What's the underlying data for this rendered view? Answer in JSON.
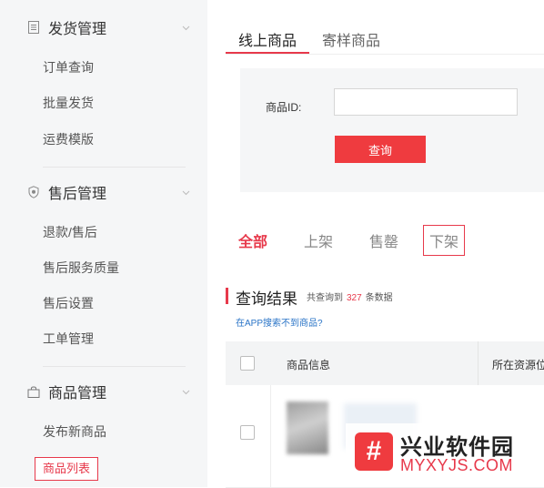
{
  "sidebar": {
    "groups": [
      {
        "title": "发货管理",
        "icon": "document-icon",
        "items": [
          {
            "label": "订单查询"
          },
          {
            "label": "批量发货"
          },
          {
            "label": "运费模版"
          }
        ]
      },
      {
        "title": "售后管理",
        "icon": "shield-icon",
        "items": [
          {
            "label": "退款/售后"
          },
          {
            "label": "售后服务质量"
          },
          {
            "label": "售后设置"
          },
          {
            "label": "工单管理"
          }
        ]
      },
      {
        "title": "商品管理",
        "icon": "bag-icon",
        "items": [
          {
            "label": "发布新商品"
          },
          {
            "label": "商品列表"
          }
        ]
      }
    ]
  },
  "main": {
    "tabs": [
      {
        "label": "线上商品"
      },
      {
        "label": "寄样商品"
      }
    ],
    "search": {
      "label": "商品ID:",
      "value": "",
      "placeholder": "",
      "button": "查询"
    },
    "filters": [
      {
        "label": "全部"
      },
      {
        "label": "上架"
      },
      {
        "label": "售罄"
      },
      {
        "label": "下架"
      }
    ],
    "result": {
      "title": "查询结果",
      "prefix": "共查询到",
      "count": "327",
      "suffix": "条数据",
      "app_link": "在APP搜索不到商品?"
    },
    "table": {
      "columns": [
        {
          "label": "商品信息"
        },
        {
          "label": "所在资源位"
        }
      ]
    }
  },
  "watermark": {
    "name": "兴业软件园",
    "url": "MYXYJS.COM"
  },
  "colors": {
    "accent": "#e7394b",
    "button": "#ef3b3f",
    "link": "#2a74c7",
    "sidebar_bg": "#f5f6f7"
  }
}
